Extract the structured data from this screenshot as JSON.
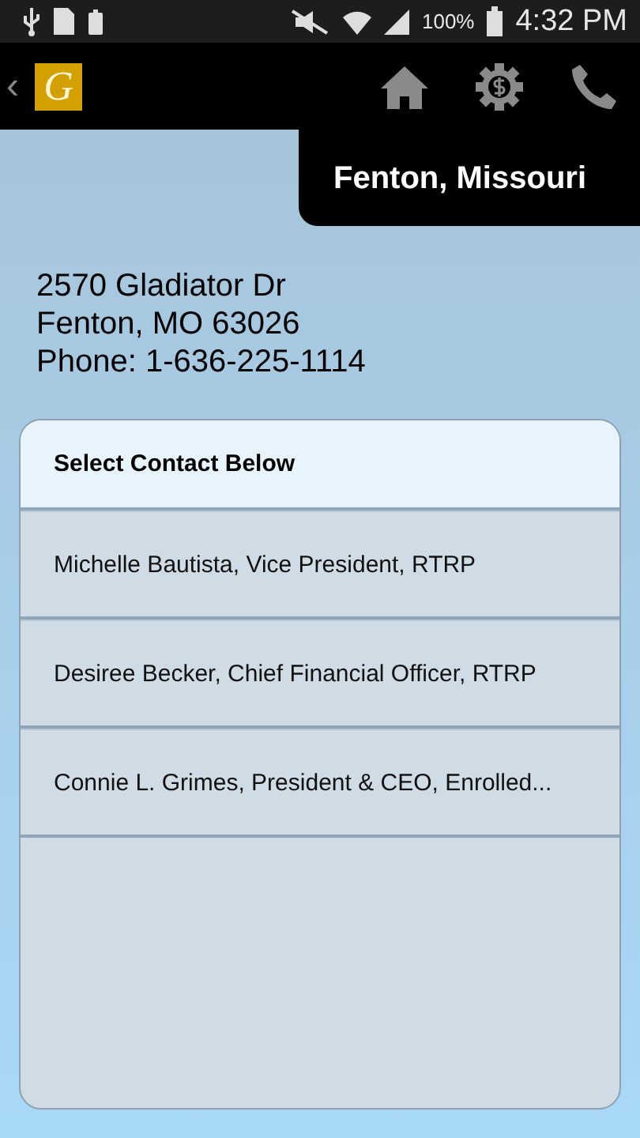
{
  "status_bar": {
    "battery_percent": "100%",
    "time": "4:32 PM"
  },
  "toolbar": {
    "back": "‹",
    "logo": "G"
  },
  "location": {
    "title": "Fenton, Missouri"
  },
  "address": {
    "lines": [
      "2570 Gladiator Dr",
      "Fenton, MO 63026",
      "Phone: 1-636-225-1114"
    ]
  },
  "contacts": {
    "header": "Select Contact Below",
    "items": [
      {
        "label": "Michelle Bautista, Vice President, RTRP"
      },
      {
        "label": "Desiree Becker, Chief Financial Officer, RTRP"
      },
      {
        "label": "Connie L. Grimes, President & CEO, Enrolled..."
      }
    ]
  }
}
